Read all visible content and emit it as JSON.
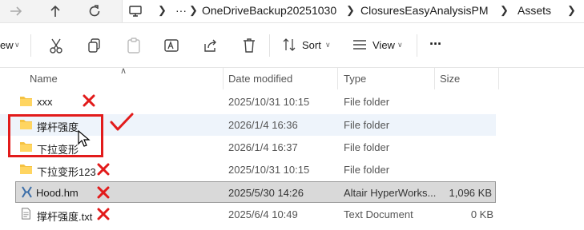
{
  "address_bar": {
    "more_label": "···",
    "crumbs": [
      "OneDriveBackup20251030",
      "ClosuresEasyAnalysisPM",
      "Assets"
    ]
  },
  "toolbar": {
    "new_partial_label": "ew",
    "sort_label": "Sort",
    "view_label": "View",
    "more_label": "···"
  },
  "columns": {
    "name": "Name",
    "date_modified": "Date modified",
    "type": "Type",
    "size": "Size"
  },
  "files": [
    {
      "name": "xxx",
      "date": "2025/10/31 10:15",
      "type": "File folder",
      "size": "",
      "icon": "folder-icon",
      "mark": "cross"
    },
    {
      "name": "撑杆强度",
      "date": "2026/1/4 16:36",
      "type": "File folder",
      "size": "",
      "icon": "folder-icon",
      "mark": "check"
    },
    {
      "name": "下拉变形",
      "date": "2026/1/4 16:37",
      "type": "File folder",
      "size": "",
      "icon": "folder-icon",
      "mark": "none"
    },
    {
      "name": "下拉变形123",
      "date": "2025/10/31 10:15",
      "type": "File folder",
      "size": "",
      "icon": "folder-icon",
      "mark": "cross"
    },
    {
      "name": "Hood.hm",
      "date": "2025/5/30 14:26",
      "type": "Altair HyperWorks...",
      "size": "1,096 KB",
      "icon": "hyperworks-file-icon",
      "mark": "cross"
    },
    {
      "name": "撑杆强度.txt",
      "date": "2025/6/4 10:49",
      "type": "Text Document",
      "size": "0 KB",
      "icon": "text-file-icon",
      "mark": "cross"
    }
  ],
  "colors": {
    "annotation_red": "#e21b1b",
    "folder_yellow": "#f5c242",
    "hover_row": "#eef4fb",
    "selected_row": "#d9d9d9"
  }
}
